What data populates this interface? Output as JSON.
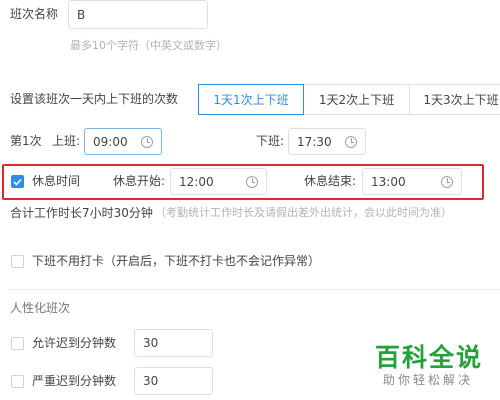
{
  "shift_name": {
    "label": "班次名称",
    "value": "B",
    "hint": "最多10个字符（中英文或数字）"
  },
  "frequency": {
    "label": "设置该班次一天内上下班的次数",
    "options": [
      "1天1次上下班",
      "1天2次上下班",
      "1天3次上下班"
    ],
    "selected_index": 0
  },
  "session": {
    "label": "第1次",
    "on_label": "上班:",
    "on_value": "09:00",
    "off_label": "下班:",
    "off_value": "17:30"
  },
  "rest": {
    "checkbox_label": "休息时间",
    "checked": true,
    "start_label": "休息开始:",
    "start_value": "12:00",
    "end_label": "休息结束:",
    "end_value": "13:00"
  },
  "total": {
    "text": "合计工作时长7小时30分钟",
    "note": "（考勤统计工作时长及请假出差外出统计，会以此时间为准）"
  },
  "no_punch": {
    "label": "下班不用打卡（开启后，下班不打卡也不会记作异常）"
  },
  "personalization": {
    "title": "人性化班次",
    "late_label": "允许迟到分钟数",
    "late_value": "30",
    "severe_label": "严重迟到分钟数",
    "severe_value": "30"
  },
  "watermark": {
    "title": "百科全说",
    "subtitle": "助你轻松解决"
  },
  "colors": {
    "accent": "#2d8cf0",
    "highlight_border": "#e0282e",
    "watermark": "#21a33a"
  }
}
